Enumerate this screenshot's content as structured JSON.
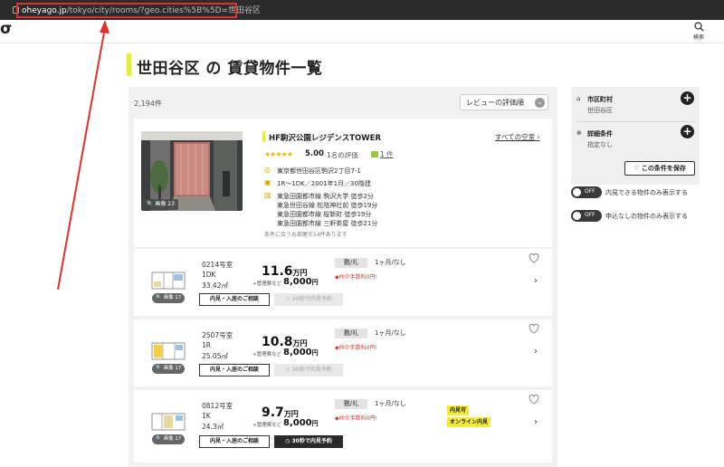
{
  "browser": {
    "url_host": "oheyago.jp",
    "url_path": "/tokyo/city/rooms/?geo.cities%5B%5D=世田谷区"
  },
  "header": {
    "logo": "σ",
    "search_label": "検索"
  },
  "page": {
    "title": "世田谷区 の 賃貸物件一覧"
  },
  "list": {
    "count": "2,194件",
    "sort_label": "レビューの評価順"
  },
  "building": {
    "name": "HF駒沢公園レジデンスTOWER",
    "all_rooms": "すべての空室",
    "stars": "★★★★★",
    "rating": "5.00",
    "reviews": "1名の評価",
    "review_link": "1 件",
    "photo_badge": "画像 23",
    "address": "東京都世田谷区駒沢2丁目7-1",
    "spec": "1R〜1DK／2001年1月／30階建",
    "stations": [
      "東急田園都市線 駒沢大学 徒歩2分",
      "東急世田谷線 松陰神社前 徒歩19分",
      "東急田園都市線 桜新町 徒歩19分",
      "東急田園都市線 三軒茶屋 徒歩21分"
    ],
    "note": "条件に合うお部屋が14件あります"
  },
  "rooms": [
    {
      "room": "0214号室",
      "layout": "1DK",
      "area": "33.42㎡",
      "rent": "11.6",
      "rent_unit": "万円",
      "fee_label": "+管理費など",
      "fee": "8,000",
      "fee_unit": "円",
      "deposit": "敷/礼",
      "months": "1ヶ月/なし",
      "fee_free": "◆仲介手数料0円!",
      "img_badge": "画像 17",
      "consult": "内見・入居のご相談",
      "visit": "30秒で内見予約"
    },
    {
      "room": "2507号室",
      "layout": "1R",
      "area": "25.05㎡",
      "rent": "10.8",
      "rent_unit": "万円",
      "fee_label": "+管理費など",
      "fee": "8,000",
      "fee_unit": "円",
      "deposit": "敷/礼",
      "months": "1ヶ月/なし",
      "fee_free": "◆仲介手数料0円!",
      "img_badge": "画像 17",
      "consult": "内見・入居のご相談",
      "visit": "30秒で内見予約"
    },
    {
      "room": "0812号室",
      "layout": "1K",
      "area": "24.3㎡",
      "rent": "9.7",
      "rent_unit": "万円",
      "fee_label": "+管理費など",
      "fee": "8,000",
      "fee_unit": "円",
      "deposit": "敷/礼",
      "months": "1ヶ月/なし",
      "fee_free": "◆仲介手数料0円!",
      "img_badge": "画像 17",
      "consult": "内見・入居のご相談",
      "visit": "30秒で内見予約",
      "tags": [
        "内見可",
        "オンライン内見"
      ]
    }
  ],
  "filters": {
    "city_label": "市区町村",
    "city_value": "世田谷区",
    "detail_label": "詳細条件",
    "detail_value": "指定なし",
    "save": "この条件を保存",
    "toggle_off": "OFF",
    "toggle1_label": "内見できる物件のみ表示する",
    "toggle2_label": "申込なしの物件のみ表示する"
  },
  "colors": {
    "accent": "#e6ed3e",
    "price_red": "#d43b2e",
    "annotation": "#e0302b"
  }
}
